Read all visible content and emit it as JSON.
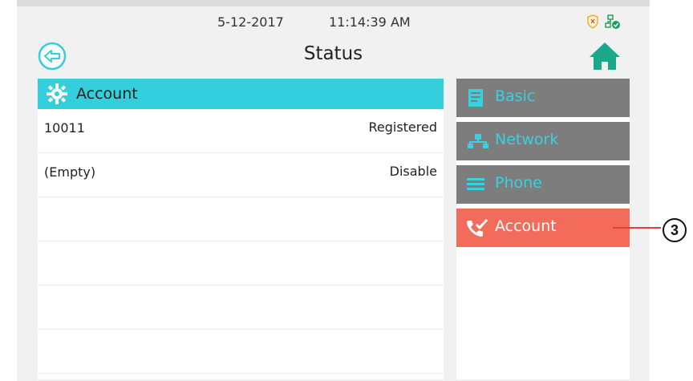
{
  "status_bar": {
    "date": "5-12-2017",
    "time": "11:14:39 AM"
  },
  "header": {
    "title": "Status"
  },
  "section": {
    "title": "Account",
    "rows": [
      {
        "name": "10011",
        "status": "Registered"
      },
      {
        "name": "(Empty)",
        "status": "Disable"
      }
    ]
  },
  "sidebar": {
    "items": [
      {
        "label": "Basic",
        "icon": "document-icon",
        "active": false
      },
      {
        "label": "Network",
        "icon": "network-icon",
        "active": false
      },
      {
        "label": "Phone",
        "icon": "list-icon",
        "active": false
      },
      {
        "label": "Account",
        "icon": "phone-account-icon",
        "active": true
      }
    ]
  },
  "callout": {
    "number": "3"
  },
  "colors": {
    "accent": "#33cfdc",
    "active": "#f26b5b",
    "inactive": "#7d7d7d",
    "home": "#1aa88a"
  }
}
